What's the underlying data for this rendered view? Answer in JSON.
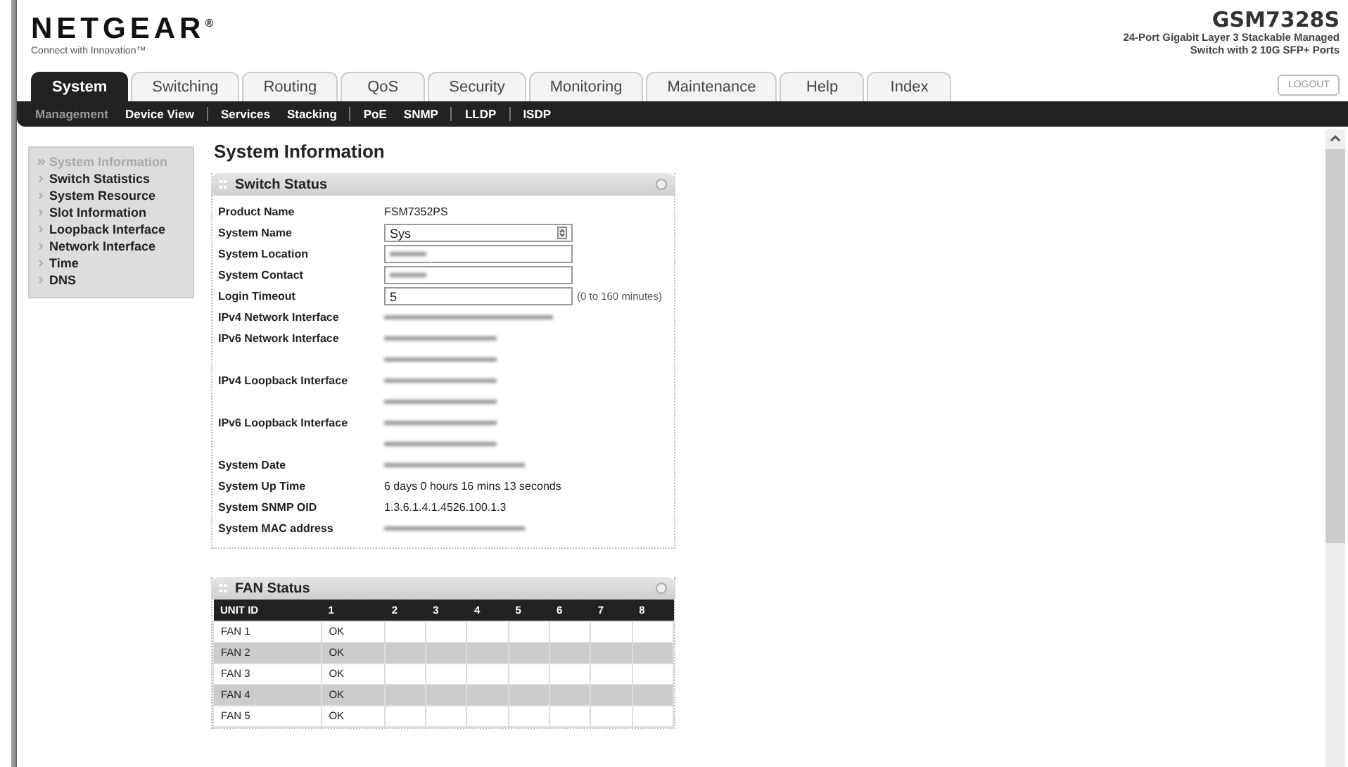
{
  "header": {
    "brand": "NETGEAR",
    "brand_mark": "®",
    "tagline": "Connect with Innovation™",
    "model": "GSM7328S",
    "description_lines": [
      "24-Port Gigabit Layer 3 Stackable Managed",
      "Switch with 2 10G SFP+ Ports"
    ],
    "logout": "LOGOUT"
  },
  "tabs": [
    {
      "label": "System",
      "selected": true
    },
    {
      "label": "Switching",
      "selected": false
    },
    {
      "label": "Routing",
      "selected": false
    },
    {
      "label": "QoS",
      "selected": false
    },
    {
      "label": "Security",
      "selected": false
    },
    {
      "label": "Monitoring",
      "selected": false
    },
    {
      "label": "Maintenance",
      "selected": false
    },
    {
      "label": "Help",
      "selected": false
    },
    {
      "label": "Index",
      "selected": false
    }
  ],
  "subnav": [
    {
      "label": "Management",
      "selected": true,
      "divider": false
    },
    {
      "label": "Device View",
      "selected": false,
      "divider": true
    },
    {
      "label": "Services",
      "selected": false,
      "divider": false
    },
    {
      "label": "Stacking",
      "selected": false,
      "divider": true
    },
    {
      "label": "PoE",
      "selected": false,
      "divider": false
    },
    {
      "label": "SNMP",
      "selected": false,
      "divider": true
    },
    {
      "label": "LLDP",
      "selected": false,
      "divider": true
    },
    {
      "label": "ISDP",
      "selected": false,
      "divider": false
    }
  ],
  "sidebar": {
    "items": [
      {
        "label": "System Information",
        "selected": true
      },
      {
        "label": "Switch Statistics",
        "selected": false
      },
      {
        "label": "System Resource",
        "selected": false
      },
      {
        "label": "Slot Information",
        "selected": false
      },
      {
        "label": "Loopback Interface",
        "selected": false
      },
      {
        "label": "Network Interface",
        "selected": false
      },
      {
        "label": "Time",
        "selected": false
      },
      {
        "label": "DNS",
        "selected": false
      }
    ]
  },
  "page_title": "System Information",
  "switch_status": {
    "title": "Switch Status",
    "rows": [
      {
        "label": "Product Name",
        "kind": "text",
        "value": "FSM7352PS"
      },
      {
        "label": "System Name",
        "kind": "spin-input",
        "value": "Sys"
      },
      {
        "label": "System Location",
        "kind": "blurred-input"
      },
      {
        "label": "System Contact",
        "kind": "blurred-input"
      },
      {
        "label": "Login Timeout",
        "kind": "input",
        "value": "5",
        "note": "(0 to 160 minutes)"
      },
      {
        "label": "IPv4 Network Interface",
        "kind": "blurred"
      },
      {
        "label": "IPv6 Network Interface",
        "kind": "blurred-double"
      },
      {
        "label": "IPv4 Loopback Interface",
        "kind": "blurred-double"
      },
      {
        "label": "IPv6 Loopback Interface",
        "kind": "blurred-double"
      },
      {
        "label": "System Date",
        "kind": "blurred"
      },
      {
        "label": "System Up Time",
        "kind": "text",
        "value": "6 days 0 hours 16 mins 13 seconds"
      },
      {
        "label": "System SNMP OID",
        "kind": "text",
        "value": "1.3.6.1.4.1.4526.100.1.3"
      },
      {
        "label": "System MAC address",
        "kind": "blurred"
      }
    ]
  },
  "fan_status": {
    "title": "FAN Status",
    "columns": [
      "UNIT ID",
      "1",
      "2",
      "3",
      "4",
      "5",
      "6",
      "7",
      "8"
    ],
    "rows": [
      [
        "FAN 1",
        "OK"
      ],
      [
        "FAN 2",
        "OK"
      ],
      [
        "FAN 3",
        "OK"
      ],
      [
        "FAN 4",
        "OK"
      ],
      [
        "FAN 5",
        "OK"
      ]
    ]
  }
}
